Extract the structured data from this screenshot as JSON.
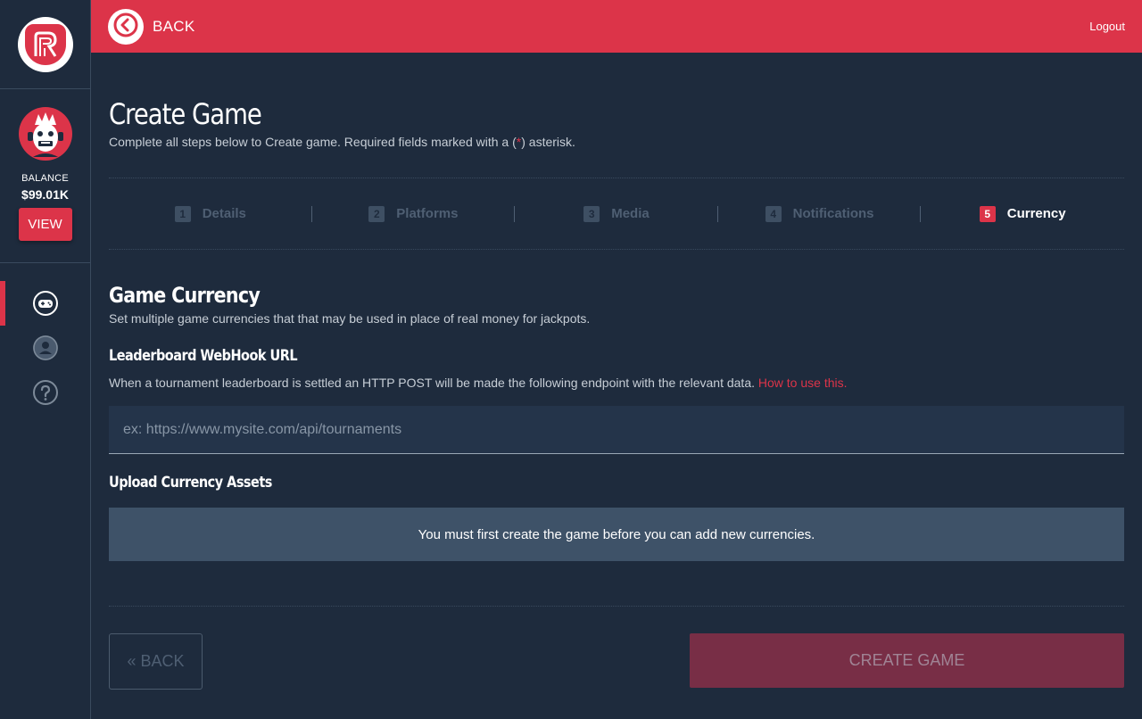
{
  "header": {
    "back_label": "BACK",
    "logout_label": "Logout"
  },
  "sidebar": {
    "balance_label": "BALANCE",
    "balance_value": "$99.01K",
    "view_label": "VIEW",
    "nav": [
      {
        "icon": "gamepad-icon",
        "active": true
      },
      {
        "icon": "user-icon",
        "active": false
      },
      {
        "icon": "help-icon",
        "active": false
      }
    ]
  },
  "page": {
    "title": "Create Game",
    "subtitle_before": "Complete all steps below to Create game. Required fields marked with a (",
    "subtitle_mark": "*",
    "subtitle_after": ") asterisk."
  },
  "steps": [
    {
      "number": "1",
      "label": "Details"
    },
    {
      "number": "2",
      "label": "Platforms"
    },
    {
      "number": "3",
      "label": "Media"
    },
    {
      "number": "4",
      "label": "Notifications"
    },
    {
      "number": "5",
      "label": "Currency",
      "active": true
    }
  ],
  "section": {
    "title": "Game Currency",
    "subtitle": "Set multiple game currencies that that may be used in place of real money for jackpots."
  },
  "webhook": {
    "title": "Leaderboard WebHook URL",
    "description": "When a tournament leaderboard is settled an HTTP POST will be made the following endpoint with the relevant data. ",
    "link_text": "How to use this.",
    "placeholder": "ex: https://www.mysite.com/api/tournaments",
    "value": ""
  },
  "upload": {
    "title": "Upload Currency Assets",
    "notice": "You must first create the game before you can add new currencies."
  },
  "footer": {
    "back_label": "« BACK",
    "create_label": "CREATE GAME"
  },
  "colors": {
    "accent": "#dc3449",
    "background": "#1e2b3d",
    "notice_bg": "#3e5268",
    "create_disabled": "#782e46"
  }
}
